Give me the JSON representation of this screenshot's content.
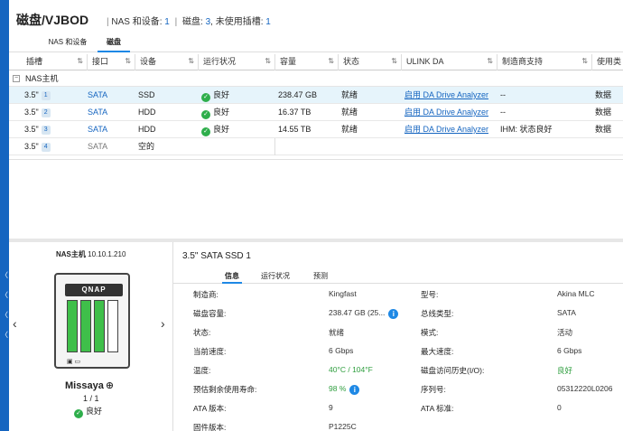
{
  "window": {
    "app_title": "磁盘/VJBOD",
    "summary_nas_label": "NAS 和设备: ",
    "summary_nas_count": "1",
    "summary_disks_label": "磁盘: ",
    "summary_disks_count": "3",
    "summary_unused_label": ", 未使用插槽: ",
    "summary_unused_count": "1"
  },
  "tabs": [
    {
      "label": "NAS 和设备",
      "active": false
    },
    {
      "label": "磁盘",
      "active": true
    }
  ],
  "table": {
    "headers": [
      "插槽",
      "接口",
      "设备",
      "运行状况",
      "容量",
      "状态",
      "ULINK DA",
      "制造商支持",
      "使用类"
    ],
    "group_label": "NAS主机",
    "group_toggle": "−",
    "rows": [
      {
        "slot": "3.5\"",
        "slot_num": "1",
        "interface": "SATA",
        "device": "SSD",
        "health": "良好",
        "capacity": "238.47 GB",
        "status": "就绪",
        "ulink": "启用 DA Drive Analyzer",
        "vendor": "--",
        "usage": "数据",
        "selected": true
      },
      {
        "slot": "3.5\"",
        "slot_num": "2",
        "interface": "SATA",
        "device": "HDD",
        "health": "良好",
        "capacity": "16.37 TB",
        "status": "就绪",
        "ulink": "启用 DA Drive Analyzer",
        "vendor": "--",
        "usage": "数据",
        "selected": false
      },
      {
        "slot": "3.5\"",
        "slot_num": "3",
        "interface": "SATA",
        "device": "HDD",
        "health": "良好",
        "capacity": "14.55 TB",
        "status": "就绪",
        "ulink": "启用 DA Drive Analyzer",
        "vendor": "IHM: 状态良好",
        "usage": "数据",
        "selected": false
      },
      {
        "slot": "3.5\"",
        "slot_num": "4",
        "interface": "SATA",
        "device": "空的",
        "health": "",
        "capacity": "",
        "status": "",
        "ulink": "",
        "vendor": "",
        "usage": "",
        "selected": false
      }
    ]
  },
  "nas": {
    "host_label": "NAS主机",
    "ip": "10.10.1.210",
    "logo": "QNAP",
    "name": "Missaya",
    "page": "1 / 1",
    "status": "良好",
    "bays_filled": [
      true,
      true,
      true,
      false
    ]
  },
  "detail": {
    "title": "3.5\" SATA SSD 1",
    "tabs": [
      "信息",
      "运行状况",
      "预测"
    ],
    "left": [
      {
        "key": "制造商:",
        "value": "Kingfast"
      },
      {
        "key": "磁盘容量:",
        "value": "238.47 GB (25..."
      },
      {
        "key": "状态:",
        "value": "就绪"
      },
      {
        "key": "当前速度:",
        "value": "6 Gbps"
      },
      {
        "key": "温度:",
        "value": "40°C / 104°F"
      },
      {
        "key": "预估剩余使用寿命:",
        "value": "98 %"
      },
      {
        "key": "ATA 版本:",
        "value": "9"
      },
      {
        "key": "固件版本:",
        "value": "P1225C"
      }
    ],
    "right": [
      {
        "key": "型号:",
        "value": "Akina MLC"
      },
      {
        "key": "总线类型:",
        "value": "SATA"
      },
      {
        "key": "模式:",
        "value": "活动"
      },
      {
        "key": "最大速度:",
        "value": "6 Gbps"
      },
      {
        "key": "磁盘访问历史(I/O):",
        "value": "良好"
      },
      {
        "key": "序列号:",
        "value": "05312220L0206"
      },
      {
        "key": "ATA 标准:",
        "value": "0"
      }
    ]
  },
  "icons": {
    "sort": "⇅",
    "ok": "✓",
    "info": "i",
    "prev": "‹",
    "next": "›",
    "zoom": "⊕"
  },
  "colors": {
    "accent": "#1e88e5",
    "link": "#1565c0",
    "ok": "#2eae4b",
    "bay_filled": "#3fbf4a",
    "selected_row": "#e6f4fb"
  }
}
